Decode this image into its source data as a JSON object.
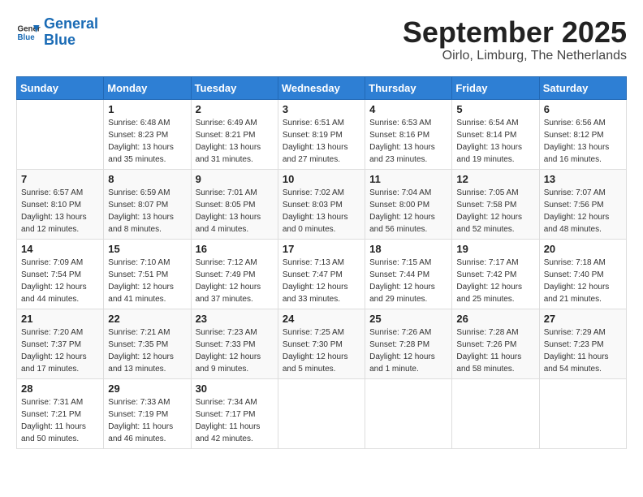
{
  "header": {
    "logo_line1": "General",
    "logo_line2": "Blue",
    "month_title": "September 2025",
    "subtitle": "Oirlo, Limburg, The Netherlands"
  },
  "days_of_week": [
    "Sunday",
    "Monday",
    "Tuesday",
    "Wednesday",
    "Thursday",
    "Friday",
    "Saturday"
  ],
  "weeks": [
    [
      {
        "day": "",
        "info": ""
      },
      {
        "day": "1",
        "info": "Sunrise: 6:48 AM\nSunset: 8:23 PM\nDaylight: 13 hours\nand 35 minutes."
      },
      {
        "day": "2",
        "info": "Sunrise: 6:49 AM\nSunset: 8:21 PM\nDaylight: 13 hours\nand 31 minutes."
      },
      {
        "day": "3",
        "info": "Sunrise: 6:51 AM\nSunset: 8:19 PM\nDaylight: 13 hours\nand 27 minutes."
      },
      {
        "day": "4",
        "info": "Sunrise: 6:53 AM\nSunset: 8:16 PM\nDaylight: 13 hours\nand 23 minutes."
      },
      {
        "day": "5",
        "info": "Sunrise: 6:54 AM\nSunset: 8:14 PM\nDaylight: 13 hours\nand 19 minutes."
      },
      {
        "day": "6",
        "info": "Sunrise: 6:56 AM\nSunset: 8:12 PM\nDaylight: 13 hours\nand 16 minutes."
      }
    ],
    [
      {
        "day": "7",
        "info": "Sunrise: 6:57 AM\nSunset: 8:10 PM\nDaylight: 13 hours\nand 12 minutes."
      },
      {
        "day": "8",
        "info": "Sunrise: 6:59 AM\nSunset: 8:07 PM\nDaylight: 13 hours\nand 8 minutes."
      },
      {
        "day": "9",
        "info": "Sunrise: 7:01 AM\nSunset: 8:05 PM\nDaylight: 13 hours\nand 4 minutes."
      },
      {
        "day": "10",
        "info": "Sunrise: 7:02 AM\nSunset: 8:03 PM\nDaylight: 13 hours\nand 0 minutes."
      },
      {
        "day": "11",
        "info": "Sunrise: 7:04 AM\nSunset: 8:00 PM\nDaylight: 12 hours\nand 56 minutes."
      },
      {
        "day": "12",
        "info": "Sunrise: 7:05 AM\nSunset: 7:58 PM\nDaylight: 12 hours\nand 52 minutes."
      },
      {
        "day": "13",
        "info": "Sunrise: 7:07 AM\nSunset: 7:56 PM\nDaylight: 12 hours\nand 48 minutes."
      }
    ],
    [
      {
        "day": "14",
        "info": "Sunrise: 7:09 AM\nSunset: 7:54 PM\nDaylight: 12 hours\nand 44 minutes."
      },
      {
        "day": "15",
        "info": "Sunrise: 7:10 AM\nSunset: 7:51 PM\nDaylight: 12 hours\nand 41 minutes."
      },
      {
        "day": "16",
        "info": "Sunrise: 7:12 AM\nSunset: 7:49 PM\nDaylight: 12 hours\nand 37 minutes."
      },
      {
        "day": "17",
        "info": "Sunrise: 7:13 AM\nSunset: 7:47 PM\nDaylight: 12 hours\nand 33 minutes."
      },
      {
        "day": "18",
        "info": "Sunrise: 7:15 AM\nSunset: 7:44 PM\nDaylight: 12 hours\nand 29 minutes."
      },
      {
        "day": "19",
        "info": "Sunrise: 7:17 AM\nSunset: 7:42 PM\nDaylight: 12 hours\nand 25 minutes."
      },
      {
        "day": "20",
        "info": "Sunrise: 7:18 AM\nSunset: 7:40 PM\nDaylight: 12 hours\nand 21 minutes."
      }
    ],
    [
      {
        "day": "21",
        "info": "Sunrise: 7:20 AM\nSunset: 7:37 PM\nDaylight: 12 hours\nand 17 minutes."
      },
      {
        "day": "22",
        "info": "Sunrise: 7:21 AM\nSunset: 7:35 PM\nDaylight: 12 hours\nand 13 minutes."
      },
      {
        "day": "23",
        "info": "Sunrise: 7:23 AM\nSunset: 7:33 PM\nDaylight: 12 hours\nand 9 minutes."
      },
      {
        "day": "24",
        "info": "Sunrise: 7:25 AM\nSunset: 7:30 PM\nDaylight: 12 hours\nand 5 minutes."
      },
      {
        "day": "25",
        "info": "Sunrise: 7:26 AM\nSunset: 7:28 PM\nDaylight: 12 hours\nand 1 minute."
      },
      {
        "day": "26",
        "info": "Sunrise: 7:28 AM\nSunset: 7:26 PM\nDaylight: 11 hours\nand 58 minutes."
      },
      {
        "day": "27",
        "info": "Sunrise: 7:29 AM\nSunset: 7:23 PM\nDaylight: 11 hours\nand 54 minutes."
      }
    ],
    [
      {
        "day": "28",
        "info": "Sunrise: 7:31 AM\nSunset: 7:21 PM\nDaylight: 11 hours\nand 50 minutes."
      },
      {
        "day": "29",
        "info": "Sunrise: 7:33 AM\nSunset: 7:19 PM\nDaylight: 11 hours\nand 46 minutes."
      },
      {
        "day": "30",
        "info": "Sunrise: 7:34 AM\nSunset: 7:17 PM\nDaylight: 11 hours\nand 42 minutes."
      },
      {
        "day": "",
        "info": ""
      },
      {
        "day": "",
        "info": ""
      },
      {
        "day": "",
        "info": ""
      },
      {
        "day": "",
        "info": ""
      }
    ]
  ]
}
